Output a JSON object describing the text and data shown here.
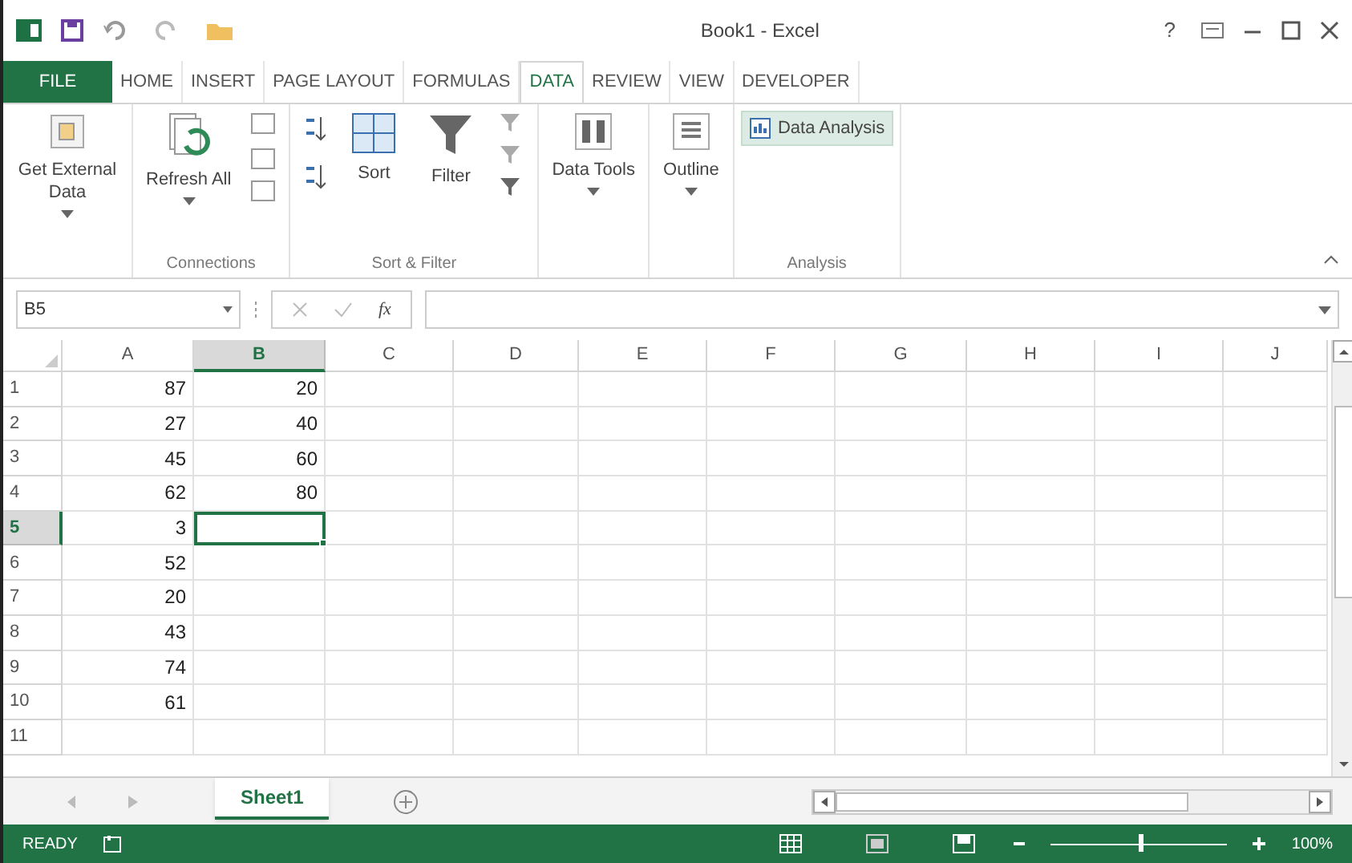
{
  "window": {
    "title": "Book1 - Excel",
    "help": "?"
  },
  "tabs": [
    {
      "label": "FILE",
      "kind": "file",
      "selected": false
    },
    {
      "label": "HOME",
      "kind": "tab",
      "selected": false
    },
    {
      "label": "INSERT",
      "kind": "tab",
      "selected": false
    },
    {
      "label": "PAGE LAYOUT",
      "kind": "tab",
      "selected": false
    },
    {
      "label": "FORMULAS",
      "kind": "tab",
      "selected": false
    },
    {
      "label": "DATA",
      "kind": "tab",
      "selected": true
    },
    {
      "label": "REVIEW",
      "kind": "tab",
      "selected": false
    },
    {
      "label": "VIEW",
      "kind": "tab",
      "selected": false
    },
    {
      "label": "DEVELOPER",
      "kind": "tab",
      "selected": false
    }
  ],
  "ribbon": {
    "groups": [
      {
        "buttons": [
          {
            "kind": "large",
            "label": "Get External Data",
            "dropdown": true
          }
        ]
      },
      {
        "label": "Connections",
        "buttons": [
          {
            "kind": "large",
            "label": "Refresh All",
            "dropdown": true
          },
          {
            "kind": "smallstack"
          }
        ]
      },
      {
        "label": "Sort & Filter",
        "buttons": [
          {
            "kind": "smallstack"
          },
          {
            "kind": "large",
            "label": "Sort",
            "dropdown": false
          },
          {
            "kind": "large",
            "label": "Filter",
            "dropdown": false
          },
          {
            "kind": "smallstack"
          }
        ]
      },
      {
        "buttons": [
          {
            "kind": "large",
            "label": "Data Tools",
            "dropdown": true
          }
        ]
      },
      {
        "buttons": [
          {
            "kind": "large",
            "label": "Outline",
            "dropdown": true
          }
        ]
      },
      {
        "label": "Analysis",
        "buttons": [
          {
            "kind": "small",
            "label": "Data Analysis",
            "selected": true
          }
        ]
      }
    ]
  },
  "formula_bar": {
    "name_box": "B5",
    "fx": "fx"
  },
  "columns": [
    {
      "label": "A",
      "selected": false
    },
    {
      "label": "B",
      "selected": true
    },
    {
      "label": "C",
      "selected": false
    },
    {
      "label": "D",
      "selected": false
    },
    {
      "label": "E",
      "selected": false
    },
    {
      "label": "F",
      "selected": false
    },
    {
      "label": "G",
      "selected": false
    },
    {
      "label": "H",
      "selected": false
    },
    {
      "label": "I",
      "selected": false
    },
    {
      "label": "J",
      "selected": false
    }
  ],
  "rows": [
    {
      "number": "1",
      "selected": false,
      "cells": [
        "87",
        "20"
      ]
    },
    {
      "number": "2",
      "selected": false,
      "cells": [
        "27",
        "40"
      ]
    },
    {
      "number": "3",
      "selected": false,
      "cells": [
        "45",
        "60"
      ]
    },
    {
      "number": "4",
      "selected": false,
      "cells": [
        "62",
        "80"
      ]
    },
    {
      "number": "5",
      "selected": true,
      "cells": [
        "3",
        ""
      ]
    },
    {
      "number": "6",
      "selected": false,
      "cells": [
        "52"
      ]
    },
    {
      "number": "7",
      "selected": false,
      "cells": [
        "20"
      ]
    },
    {
      "number": "8",
      "selected": false,
      "cells": [
        "43"
      ]
    },
    {
      "number": "9",
      "selected": false,
      "cells": [
        "74"
      ]
    },
    {
      "number": "10",
      "selected": false,
      "cells": [
        "61"
      ]
    },
    {
      "number": "11",
      "selected": false,
      "cells": []
    }
  ],
  "sheets": [
    {
      "label": "Sheet1",
      "selected": true
    }
  ],
  "status_bar": {
    "status": "READY",
    "zoom": "100%",
    "level": 0.5
  }
}
